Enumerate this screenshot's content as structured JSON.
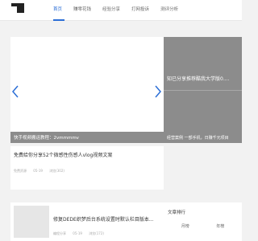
{
  "nav": {
    "items": [
      {
        "label": "首页",
        "active": true
      },
      {
        "label": "赚零花钱",
        "active": false
      },
      {
        "label": "经验分享",
        "active": false
      },
      {
        "label": "打网投诉",
        "active": false
      },
      {
        "label": "测评分析",
        "active": false
      }
    ]
  },
  "slider": {
    "caption": "快手视频搬运教程：2vmmmmv"
  },
  "side_card": {
    "title": "知已分享推荐酷我大学版0....",
    "subtitle": "经营案例 一部手机，日赚千元项目"
  },
  "articles": [
    {
      "title": "免费给你分享52个微感性伤感人vlog视频文案",
      "author": "免费资源",
      "date": "05-19",
      "views": "浏览(302)"
    },
    {
      "title": "修复DEDE织梦后台系统设置时默认栏目版本...",
      "author": "编程分享",
      "date": "05-19",
      "views": "浏览(172)"
    }
  ],
  "rank": {
    "title": "文章排行",
    "tabs": [
      "月榜",
      "年榜"
    ]
  },
  "colors": {
    "accent": "#2b6ed6",
    "background": "#f2f2f2",
    "side_card": "#8c8c8c"
  }
}
